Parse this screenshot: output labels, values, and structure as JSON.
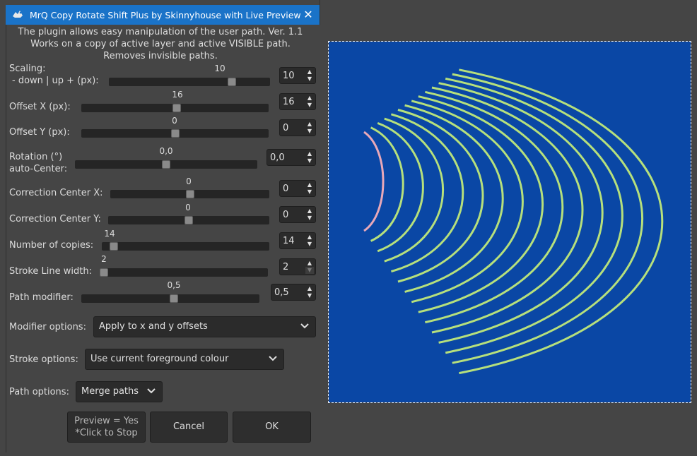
{
  "window": {
    "title": "MrQ Copy Rotate Shift Plus by Skinnyhouse with Live Preview"
  },
  "description": [
    "The plugin allows easy manipulation of the user path. Ver. 1.1",
    "Works on a copy of active layer and active VISIBLE path.",
    "Removes invisible paths."
  ],
  "params": {
    "scaling": {
      "label1": "Scaling:",
      "label2": "- down | up + (px):",
      "value": "10",
      "fraction": 0.78
    },
    "offset_x": {
      "label": "Offset X (px):",
      "value": "16",
      "fraction": 0.51
    },
    "offset_y": {
      "label": "Offset Y (px):",
      "value": "0",
      "fraction": 0.5
    },
    "rotation": {
      "label1": "Rotation (°)",
      "label2": "auto-Center:",
      "value": "0,0",
      "fraction": 0.5
    },
    "corr_x": {
      "label": "Correction Center X:",
      "value": "0",
      "fraction": 0.5
    },
    "corr_y": {
      "label": "Correction Center Y:",
      "value": "0",
      "fraction": 0.5
    },
    "copies": {
      "label": "Number of copies:",
      "value": "14",
      "fraction": 0.05
    },
    "stroke_width": {
      "label": "Stroke Line width:",
      "value": "2",
      "fraction": 0.0
    },
    "path_modifier": {
      "label": "Path modifier:",
      "value": "0,5",
      "fraction": 0.52
    }
  },
  "options": {
    "modifier": {
      "label": "Modifier options:",
      "value": "Apply to x and y offsets"
    },
    "stroke": {
      "label": "Stroke options:",
      "value": "Use current foreground colour"
    },
    "path": {
      "label": "Path options:",
      "value": "Merge paths"
    }
  },
  "buttons": {
    "preview_line1": "Preview = Yes",
    "preview_line2": "*Click to Stop",
    "cancel": "Cancel",
    "ok": "OK"
  },
  "colors": {
    "title_bar": "#1a73c8",
    "canvas_bg": "#0a47a5",
    "stroke": "#b6e07c",
    "source_path": "#e8a8b8"
  },
  "icons": {
    "app": "gimp-wilber-icon",
    "close": "close-icon",
    "dropdown": "chevron-down-icon"
  }
}
